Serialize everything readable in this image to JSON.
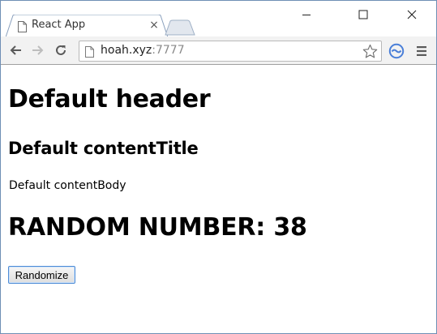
{
  "browser": {
    "tab": {
      "title": "React App",
      "close_glyph": "×",
      "icon": "page-icon"
    },
    "window_controls": {
      "minimize_icon": "minimize-icon",
      "maximize_icon": "maximize-icon",
      "close_icon": "close-icon"
    },
    "toolbar": {
      "back_icon": "back-arrow-icon",
      "forward_icon": "forward-arrow-icon",
      "reload_icon": "reload-icon",
      "address": {
        "host": "hoah.xyz",
        "port": ":7777"
      },
      "bookmark_icon": "star-icon",
      "extension_icon": "extension-icon",
      "menu_icon": "hamburger-menu-icon"
    },
    "colors": {
      "frame_border": "#6f8fb5",
      "toolbar_bg": "#f2f2f2",
      "extension_blue": "#4a7fd8"
    }
  },
  "page": {
    "header": "Default header",
    "content_title": "Default contentTitle",
    "content_body": "Default contentBody",
    "random_label": "RANDOM NUMBER: 38",
    "randomize_button": "Randomize"
  }
}
